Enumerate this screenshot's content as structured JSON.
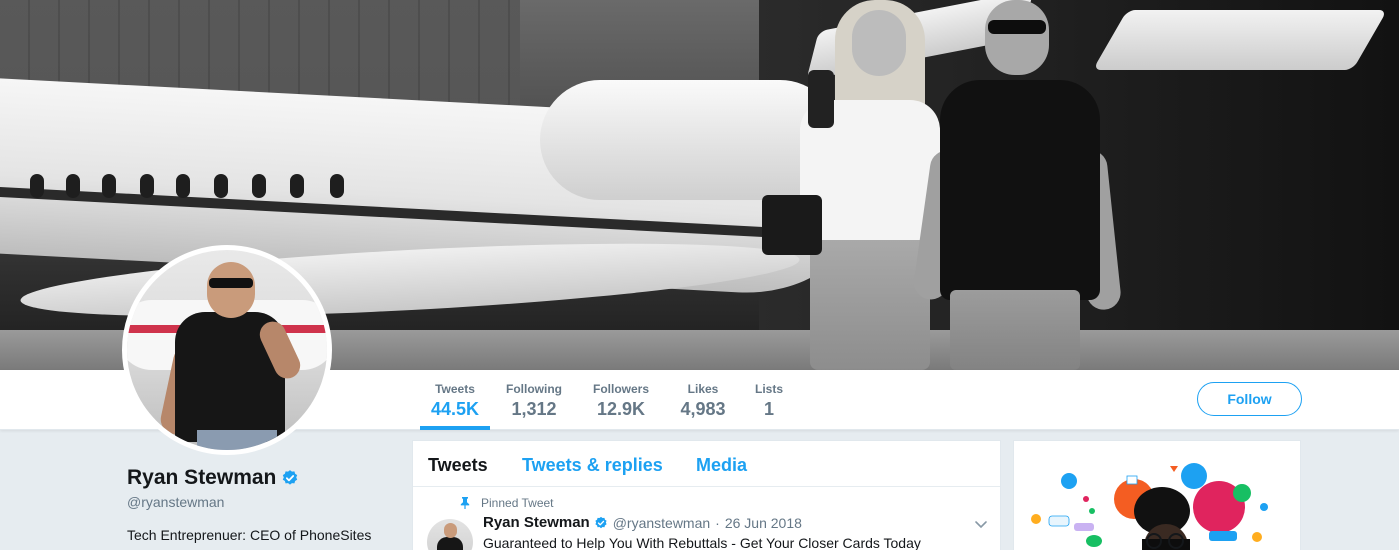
{
  "profile": {
    "name": "Ryan Stewman",
    "handle": "@ryanstewman",
    "bio": "Tech Entreprenuer: CEO of PhoneSites"
  },
  "stats": [
    {
      "label": "Tweets",
      "value": "44.5K"
    },
    {
      "label": "Following",
      "value": "1,312"
    },
    {
      "label": "Followers",
      "value": "12.9K"
    },
    {
      "label": "Likes",
      "value": "4,983"
    },
    {
      "label": "Lists",
      "value": "1"
    }
  ],
  "follow_button": "Follow",
  "timeline": {
    "tabs": [
      "Tweets",
      "Tweets & replies",
      "Media"
    ],
    "active_tab": "Tweets",
    "pinned_label": "Pinned Tweet",
    "tweet": {
      "name": "Ryan Stewman",
      "handle": "@ryanstewman",
      "separator": "·",
      "date": "26 Jun 2018",
      "text": "Guaranteed to Help You With Rebuttals - Get Your Closer Cards Today"
    }
  },
  "colors": {
    "accent": "#1da1f2",
    "secondary_text": "#657786",
    "page_bg": "#e6ecf0"
  },
  "icons": {
    "verified": "verified-badge-icon",
    "pin": "pin-icon",
    "caret": "chevron-down-icon"
  }
}
